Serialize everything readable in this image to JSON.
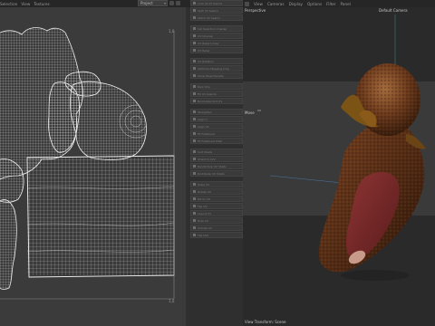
{
  "uv_editor": {
    "menu": [
      "Selection",
      "View",
      "Textures"
    ],
    "project_select": "Project",
    "corner_top": "1,0",
    "corner_bottom": "1,0"
  },
  "tool_panel": {
    "groups": [
      [
        "Look At UV Seams",
        "Split UV Seams",
        "Stitch UV Seams"
      ],
      [
        "Set Selection Unwrap",
        "UV Unwrap",
        "UV Relax Loose",
        "UV Relax"
      ],
      [
        "UV Rotation",
        "Optimize Mapping Only",
        "Show Texel Density"
      ],
      [
        "Pack UVs",
        "Fill UV Islands",
        "Normalize Unit UV"
      ],
      [
        "Straighten",
        "Align U",
        "Align UV",
        "Fit Flattened",
        "Fit Flattened Shell"
      ],
      [
        "Sort Shells",
        "Orient to U/V",
        "Randomize UV Shells",
        "Distribute UV Shells"
      ],
      [
        "Scale UV",
        "Rotate UV",
        "Mirror UV",
        "Flip UV",
        "Layout UV",
        "Hide UV",
        "Unhide UV",
        "Tile UVs"
      ]
    ]
  },
  "viewport": {
    "menu": [
      "View",
      "Cameras",
      "Display",
      "Options",
      "Filter",
      "Panel"
    ],
    "label": "Perspective",
    "camera": "Default Camera",
    "move_label": "Move",
    "footer": "View Transform: Scene"
  },
  "colors": {
    "uv_background": "#3b3b3b",
    "uv_wire": "#e6e6e6",
    "viewport_background": "#2a2a2a",
    "object_primary": "#6b3a1d",
    "object_accent": "#8a2a2a"
  }
}
